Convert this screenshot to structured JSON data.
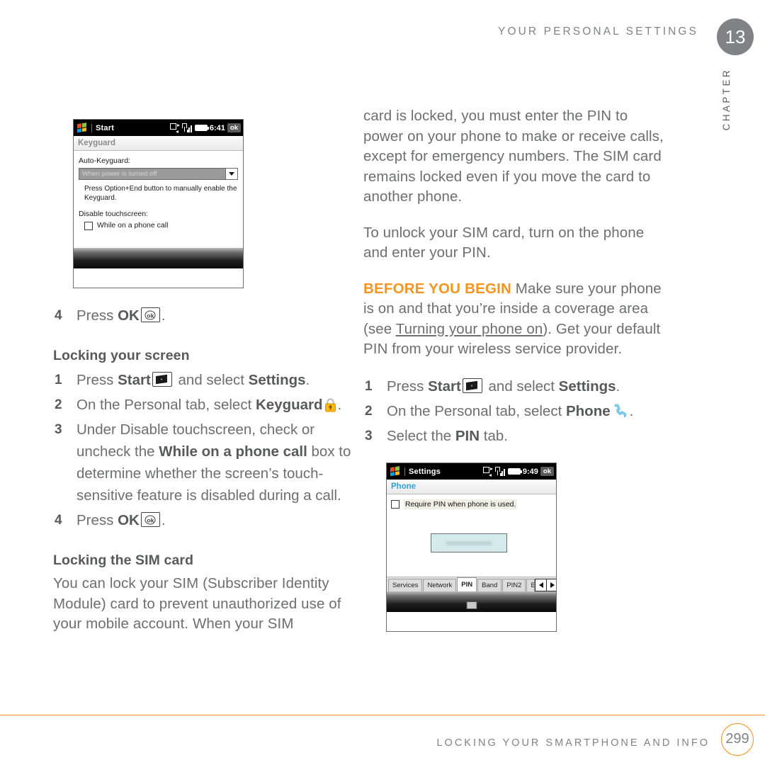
{
  "header": {
    "running_head": "YOUR PERSONAL SETTINGS",
    "chapter_number": "13",
    "chapter_label": "CHAPTER"
  },
  "footer": {
    "running_foot": "LOCKING YOUR SMARTPHONE AND INFO",
    "page_number": "299",
    "rule_color": "#f7941e"
  },
  "left_column": {
    "step_press_ok_1": {
      "num": "4",
      "before": "Press ",
      "bold": "OK",
      "after": "."
    },
    "section_locking_screen": "Locking your screen",
    "locking_screen_steps": {
      "s1": {
        "num": "1",
        "a": "Press ",
        "b": "Start",
        "c": " and select ",
        "d": "Settings",
        "e": "."
      },
      "s2": {
        "num": "2",
        "a": "On the Personal tab, select ",
        "b": "Keyguard",
        "c": "."
      },
      "s3": {
        "num": "3",
        "a": "Under Disable touchscreen, check or uncheck the ",
        "b": "While on a phone call",
        "c": " box to determine whether the screen’s touch-sensitive feature is disabled during a call."
      },
      "s4": {
        "num": "4",
        "a": "Press ",
        "b": "OK",
        "c": "."
      }
    },
    "section_locking_sim": "Locking the SIM card",
    "sim_paragraph": "You can lock your SIM (Subscriber Identity Module) card to prevent unauthorized use of your mobile account. When your SIM"
  },
  "right_column": {
    "paragraph_1": "card is locked, you must enter the PIN to power on your phone to make or receive calls, except for emergency numbers. The SIM card remains locked even if you move the card to another phone.",
    "paragraph_2": "To unlock your SIM card, turn on the phone and enter your PIN.",
    "before_you_begin": {
      "lead": "BEFORE YOU BEGIN",
      "lead_color": "#f7941e",
      "a": " Make sure your phone is on and that you’re inside a coverage area (see ",
      "link": "Turning your phone on",
      "b": "). Get your default PIN from your wireless service provider."
    },
    "steps": {
      "s1": {
        "num": "1",
        "a": "Press ",
        "b": "Start",
        "c": " and select ",
        "d": "Settings",
        "e": "."
      },
      "s2": {
        "num": "2",
        "a": "On the Personal tab, select ",
        "b": "Phone",
        "c": "."
      },
      "s3": {
        "num": "3",
        "a": "Select the ",
        "b": "PIN",
        "c": " tab."
      }
    }
  },
  "device_keyguard": {
    "titlebar": {
      "start_label": "Start",
      "clock": "6:41",
      "ok_label": "ok"
    },
    "header": "Keyguard",
    "auto_keyguard_label": "Auto-Keyguard:",
    "auto_keyguard_value": "When power is turned off",
    "help_text": "Press Option+End button to manually enable the Keyguard.",
    "disable_touchscreen_label": "Disable touchscreen:",
    "checkbox_label": "While on a phone call",
    "checkbox_checked": false
  },
  "device_phone_pin": {
    "titlebar": {
      "start_label": "Settings",
      "clock": "9:49",
      "ok_label": "ok"
    },
    "header": "Phone",
    "checkbox_label": "Require PIN when phone is used.",
    "checkbox_checked": false,
    "tabs": [
      "Services",
      "Network",
      "PIN",
      "Band",
      "PIN2",
      "Be"
    ],
    "active_tab": "PIN",
    "arrow_left": "◄",
    "arrow_right": "►"
  }
}
